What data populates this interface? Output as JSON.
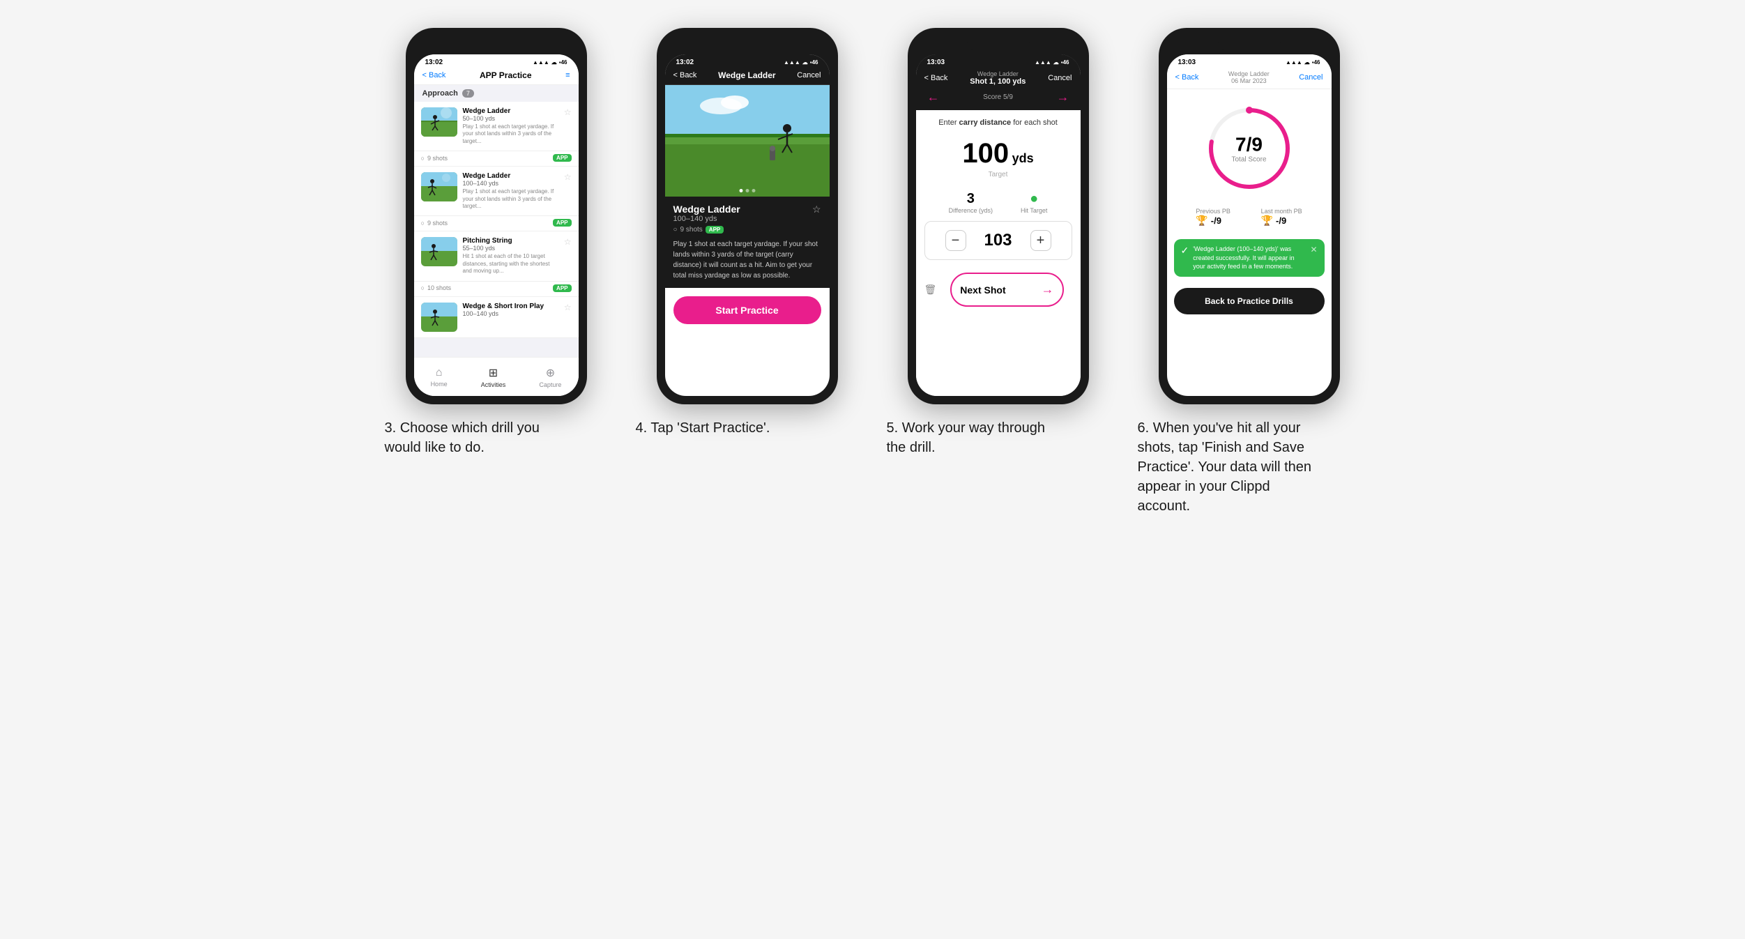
{
  "page": {
    "background": "#f5f5f5"
  },
  "steps": [
    {
      "number": "3",
      "caption": "3. Choose which drill you would like to do.",
      "phone": {
        "status_time": "13:02",
        "nav_back": "< Back",
        "nav_title": "APP Practice",
        "nav_menu": "≡",
        "section_label": "Approach",
        "section_count": "7",
        "drills": [
          {
            "name": "Wedge Ladder",
            "yds": "50–100 yds",
            "desc": "Play 1 shot at each target yardage. If your shot lands within 3 yards of the target...",
            "shots": "9 shots",
            "badge": "APP"
          },
          {
            "name": "Wedge Ladder",
            "yds": "100–140 yds",
            "desc": "Play 1 shot at each target yardage. If your shot lands within 3 yards of the target...",
            "shots": "9 shots",
            "badge": "APP"
          },
          {
            "name": "Pitching String",
            "yds": "55–100 yds",
            "desc": "Hit 1 shot at each of the 10 target distances, starting with the shortest and moving up...",
            "shots": "10 shots",
            "badge": "APP"
          },
          {
            "name": "Wedge & Short Iron Play",
            "yds": "100–140 yds",
            "desc": "",
            "shots": "",
            "badge": ""
          }
        ],
        "tabs": [
          {
            "label": "Home",
            "icon": "⌂",
            "active": false
          },
          {
            "label": "Activities",
            "icon": "♟",
            "active": true
          },
          {
            "label": "Capture",
            "icon": "⊕",
            "active": false
          }
        ]
      }
    },
    {
      "number": "4",
      "caption": "4. Tap 'Start Practice'.",
      "phone": {
        "status_time": "13:02",
        "nav_back": "< Back",
        "nav_title": "Wedge Ladder",
        "nav_cancel": "Cancel",
        "drill_name": "Wedge Ladder",
        "drill_yds": "100–140 yds",
        "drill_shots": "9 shots",
        "drill_badge": "APP",
        "drill_desc": "Play 1 shot at each target yardage. If your shot lands within 3 yards of the target (carry distance) it will count as a hit. Aim to get your total miss yardage as low as possible.",
        "start_btn": "Start Practice"
      }
    },
    {
      "number": "5",
      "caption": "5. Work your way through the drill.",
      "phone": {
        "status_time": "13:03",
        "nav_back": "< Back",
        "nav_title_small": "Wedge Ladder",
        "nav_title_main": "Shot 1, 100 yds",
        "nav_score": "Score 5/9",
        "nav_cancel": "Cancel",
        "carry_instruction": "Enter carry distance for each shot",
        "target_value": "100",
        "target_unit": "yds",
        "target_label": "Target",
        "difference_value": "3",
        "difference_label": "Difference (yds)",
        "hit_target_label": "Hit Target",
        "input_value": "103",
        "next_shot_btn": "Next Shot"
      }
    },
    {
      "number": "6",
      "caption": "6. When you've hit all your shots, tap 'Finish and Save Practice'. Your data will then appear in your Clippd account.",
      "phone": {
        "status_time": "13:03",
        "nav_back": "< Back",
        "nav_title_small": "Wedge Ladder",
        "nav_title_date": "06 Mar 2023",
        "nav_cancel": "Cancel",
        "score_value": "7",
        "score_total": "9",
        "score_fraction": "7/9",
        "total_score_label": "Total Score",
        "previous_pb_label": "Previous PB",
        "previous_pb_value": "-/9",
        "last_month_pb_label": "Last month PB",
        "last_month_pb_value": "-/9",
        "toast_text": "'Wedge Ladder (100–140 yds)' was created successfully. It will appear in your activity feed in a few moments.",
        "back_btn": "Back to Practice Drills"
      }
    }
  ]
}
